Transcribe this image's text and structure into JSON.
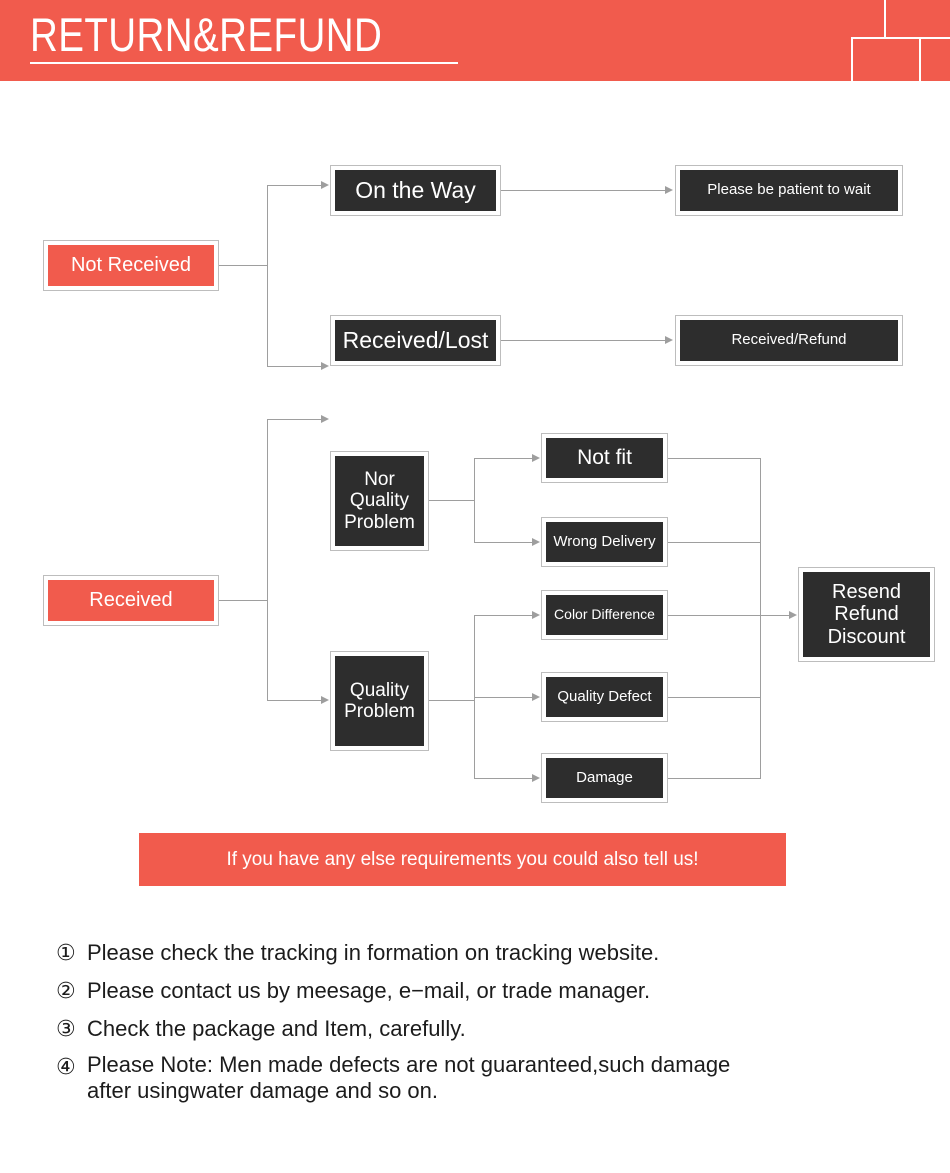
{
  "header": {
    "title": "RETURN&REFUND",
    "accent_color": "#f15b4d",
    "text_color": "#ffffff"
  },
  "colors": {
    "accent_red": "#f15b4d",
    "node_dark": "#2d2d2d",
    "node_border": "#bdbdbd",
    "connector": "#9e9e9e",
    "body_text": "#1c1c1c",
    "page_background": "#ffffff"
  },
  "flow": {
    "branch_not_received": {
      "root": {
        "label": "Not Received",
        "style": "red"
      },
      "steps": [
        {
          "label": "On the Way",
          "style": "dark",
          "result": {
            "label": "Please be patient to wait",
            "style": "dark"
          }
        },
        {
          "label": "Received/Lost",
          "style": "dark",
          "result": {
            "label": "Received/Refund",
            "style": "dark"
          }
        }
      ]
    },
    "branch_received": {
      "root": {
        "label": "Received",
        "style": "red"
      },
      "categories": [
        {
          "label": "Nor\nQuality\nProblem",
          "style": "dark",
          "reasons": [
            {
              "label": "Not fit",
              "style": "dark"
            },
            {
              "label": "Wrong Delivery",
              "style": "dark"
            }
          ]
        },
        {
          "label": "Quality\nProblem",
          "style": "dark",
          "reasons": [
            {
              "label": "Color Difference",
              "style": "dark"
            },
            {
              "label": "Quality Defect",
              "style": "dark"
            },
            {
              "label": "Damage",
              "style": "dark"
            }
          ]
        }
      ],
      "outcome": {
        "label": "Resend\nRefund\nDiscount",
        "style": "dark"
      }
    }
  },
  "note_bar": {
    "text": "If you have any else requirements you could also tell us!"
  },
  "notes": [
    {
      "marker": "①",
      "text": "Please check the tracking in formation on tracking website."
    },
    {
      "marker": "②",
      "text": "Please contact us by meesage, e−mail, or trade manager."
    },
    {
      "marker": "③",
      "text": "Check the package and Item, carefully."
    },
    {
      "marker": "④",
      "text": "Please Note: Men made defects are not guaranteed,such damage\nafter usingwater damage and so on."
    }
  ]
}
